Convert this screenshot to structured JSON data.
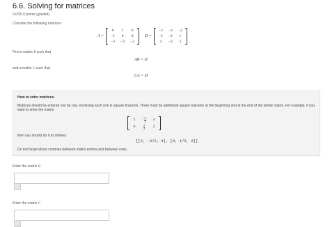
{
  "page": {
    "title": "6.6. Solving for matrices",
    "points": "0.0/20.0 points (graded)"
  },
  "problem": {
    "intro": "Consider the following matrices:",
    "matrix_A_label": "A =",
    "matrix_A": [
      [
        "0",
        "1",
        "0"
      ],
      [
        "−1",
        "0",
        "0"
      ],
      [
        "−3",
        "−3",
        "−2"
      ]
    ],
    "matrix_D_label": "D =",
    "matrix_D": [
      [
        "−3",
        "−3",
        "−2"
      ],
      [
        "−2",
        "−2",
        "1"
      ],
      [
        "4",
        "−3",
        "3"
      ]
    ],
    "find_B_text": "Find a matrix",
    "find_B_var": "B",
    "find_B_suffix": "such that",
    "eq_AB": "AB = D",
    "find_C_text": "and a matrix",
    "find_C_var": "C",
    "find_C_suffix": "such that",
    "eq_CA": "CA = D"
  },
  "help": {
    "heading": "How to enter matrices.",
    "body": "Matrices should be entered row by row, enclosing each row in square brackets. There must be additional square brackets at the beginning and at the end of the whole matrix. For example, if you want to enter the matrix",
    "example_row1": [
      "2",
      "−",
      "4"
    ],
    "example_frac": [
      "3",
      "2"
    ],
    "example_row2": [
      "0",
      "",
      "2"
    ],
    "example_frac2": [
      "1",
      "2"
    ],
    "then_text": "then you should do it as follows:",
    "code": "[[2, -3/2, 4], [0, 1/2, 2]]",
    "warning": "Do not forget about commas between matrix entries and between rows."
  },
  "answers": {
    "enter_B_label": "Enter the matrix",
    "enter_B_var": "B",
    "input_B_value": "",
    "enter_C_label": "Enter the matrix",
    "enter_C_var": "C",
    "input_C_value": ""
  }
}
